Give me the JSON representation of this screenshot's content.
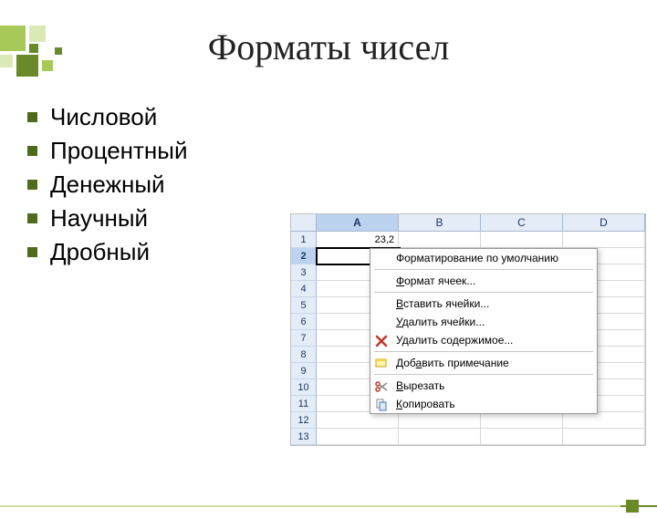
{
  "title": "Форматы чисел",
  "bullets": [
    "Числовой",
    "Процентный",
    "Денежный",
    "Научный",
    "Дробный"
  ],
  "sheet": {
    "columns": [
      "A",
      "B",
      "C",
      "D"
    ],
    "rows": [
      "1",
      "2",
      "3",
      "4",
      "5",
      "6",
      "7",
      "8",
      "9",
      "10",
      "11",
      "12",
      "13"
    ],
    "activeRow": 2,
    "activeCol": "A",
    "cellA1": "23,2"
  },
  "menu": {
    "defaultFormatting": "Форматирование по умолчанию",
    "cellFormat": "Формат ячеек...",
    "insertCells": "Вставить ячейки...",
    "deleteCells": "Удалить ячейки...",
    "deleteContent": "Удалить содержимое...",
    "addComment": "Добавить примечание",
    "cut": "Вырезать",
    "copy": "Копировать"
  }
}
